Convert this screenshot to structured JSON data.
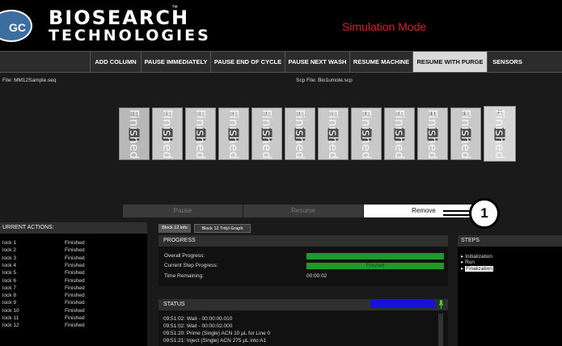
{
  "header": {
    "logo_text": "GC",
    "brand_line1": "BIOSEARCH",
    "brand_line2": "TECHNOLOGIES",
    "trademark": "™",
    "mode": "Simulation Mode",
    "mode_color": "#e01b1b"
  },
  "toolbar": {
    "items": [
      {
        "label": "ADD COLUMN"
      },
      {
        "label": "PAUSE IMMEDIATELY"
      },
      {
        "label": "PAUSE END OF CYCLE"
      },
      {
        "label": "PAUSE NEXT WASH"
      },
      {
        "label": "RESUME MACHINE"
      },
      {
        "label": "RESUME WITH PURGE"
      },
      {
        "label": "SENSORS"
      }
    ]
  },
  "files": {
    "seq": "File:  MM12Sample.seq",
    "scp": "Scp File:  Bio1umole.scp"
  },
  "columns": [
    {
      "num": "1",
      "state": "Finished"
    },
    {
      "num": "2",
      "state": "Finished"
    },
    {
      "num": "3",
      "state": "Finished"
    },
    {
      "num": "4",
      "state": "Finished"
    },
    {
      "num": "5",
      "state": "Finished"
    },
    {
      "num": "6",
      "state": "Finished"
    },
    {
      "num": "7",
      "state": "Finished"
    },
    {
      "num": "8",
      "state": "Finished"
    },
    {
      "num": "9",
      "state": "Finished"
    },
    {
      "num": "10",
      "state": "Finished"
    },
    {
      "num": "11",
      "state": "Finished"
    },
    {
      "num": "12",
      "state": "Finished"
    }
  ],
  "controls": {
    "pause": "Pause",
    "resume": "Resume",
    "remove": "Remove"
  },
  "callout": "1",
  "current_actions": {
    "title": "URRENT ACTIONS:",
    "rows": [
      {
        "name": "lock 1",
        "state": "Finished"
      },
      {
        "name": "lock 2",
        "state": "Finished"
      },
      {
        "name": "lock 3",
        "state": "Finished"
      },
      {
        "name": "lock 4",
        "state": "Finished"
      },
      {
        "name": "lock 5",
        "state": "Finished"
      },
      {
        "name": "lock 6",
        "state": "Finished"
      },
      {
        "name": "lock 7",
        "state": "Finished"
      },
      {
        "name": "lock 8",
        "state": "Finished"
      },
      {
        "name": "lock 9",
        "state": "Finished"
      },
      {
        "name": "lock 10",
        "state": "Finished"
      },
      {
        "name": "lock 11",
        "state": "Finished"
      },
      {
        "name": "lock 12",
        "state": "Finished"
      }
    ]
  },
  "tabs": [
    {
      "label": "Block 12 info"
    },
    {
      "label": "Block 12 Trityl Graph"
    }
  ],
  "progress": {
    "title": "PROGRESS",
    "overall_label": "Overall Progress:",
    "overall_fraction": 1.0,
    "current_label": "Current Step Progress:",
    "current_text": "Finished",
    "current_fraction": 1.0,
    "time_label": "Time Remaining:",
    "time_value": "00:00:02"
  },
  "status": {
    "title": "STATUS",
    "lines": [
      "09:51:02: Wait - 00:00:00.010",
      "09:51:02: Wait - 00:00:02.000",
      "09:51:20: Prime (Single) ACN 10 µL for Line 0",
      "09:51:21: Inject (Single) ACN 275 µL into A1"
    ]
  },
  "steps": {
    "title": "STEPS",
    "items": [
      {
        "label": "Initialization"
      },
      {
        "label": "Run"
      },
      {
        "label": "Finalization"
      }
    ]
  }
}
